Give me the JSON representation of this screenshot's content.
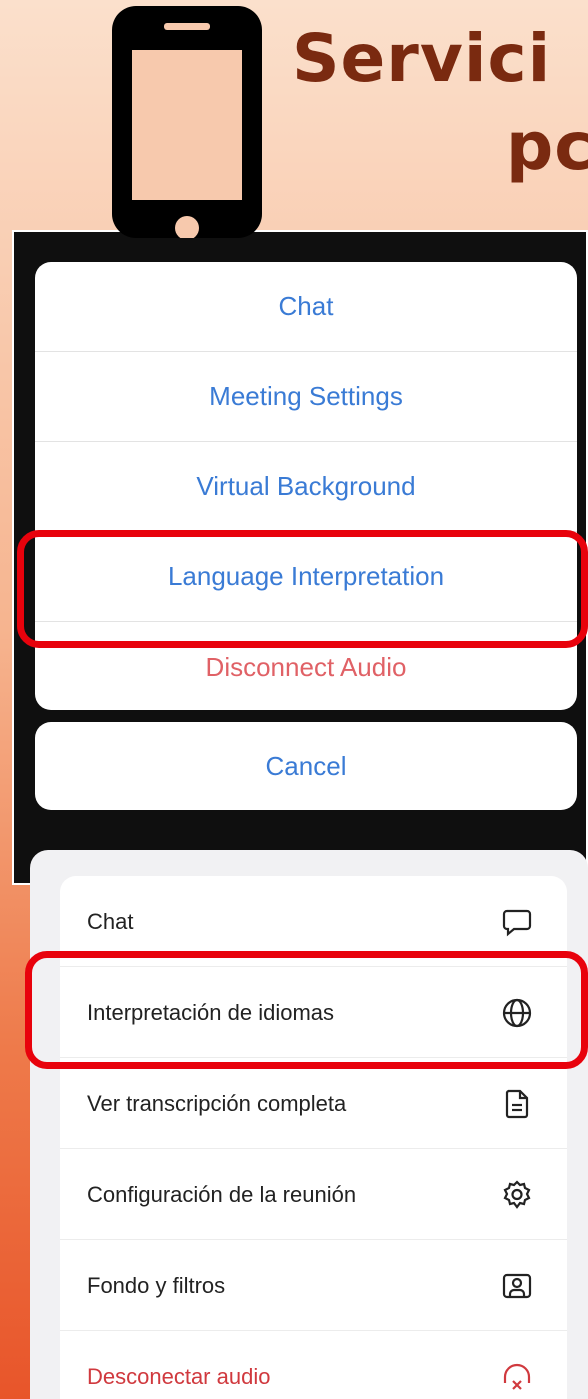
{
  "header": {
    "title_line_1": "Servici",
    "title_line_2": "pc"
  },
  "english_menu": {
    "items": [
      {
        "label": "Chat"
      },
      {
        "label": "Meeting Settings"
      },
      {
        "label": "Virtual Background"
      },
      {
        "label": "Language Interpretation"
      },
      {
        "label": "Disconnect Audio"
      }
    ],
    "cancel_label": "Cancel"
  },
  "spanish_menu": {
    "items": [
      {
        "label": "Chat",
        "icon": "chat-bubble-icon"
      },
      {
        "label": "Interpretación de idiomas",
        "icon": "globe-icon"
      },
      {
        "label": "Ver transcripción completa",
        "icon": "document-icon"
      },
      {
        "label": "Configuración de la reunión",
        "icon": "gear-icon"
      },
      {
        "label": "Fondo y filtros",
        "icon": "portrait-icon"
      },
      {
        "label": "Desconectar audio",
        "icon": "headphones-disconnect-icon"
      }
    ]
  },
  "colors": {
    "title": "#7a2a10",
    "link_blue": "#3a7bd5",
    "danger_red": "#e06166",
    "highlight": "#e8020c"
  }
}
